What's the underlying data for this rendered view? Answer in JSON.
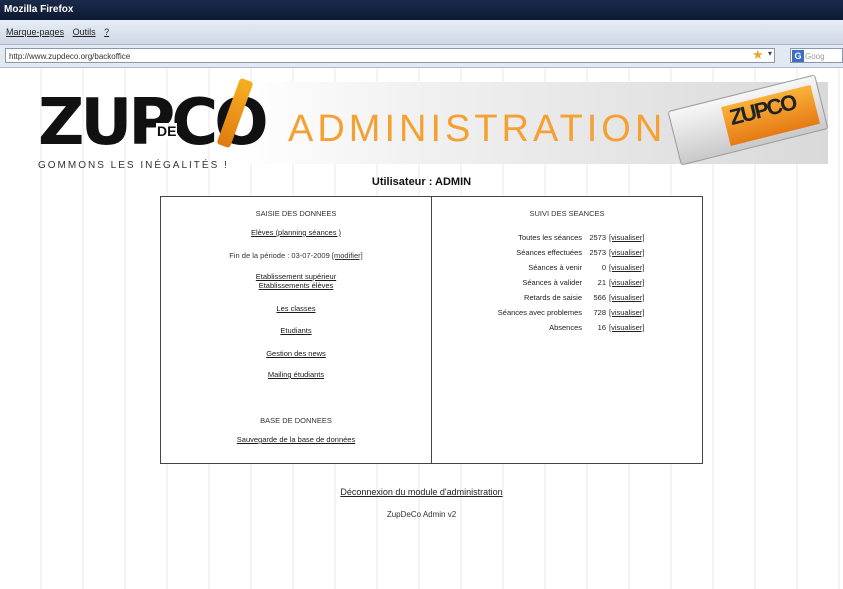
{
  "window": {
    "title": "Mozilla Firefox"
  },
  "menu": [
    "Marque-pages",
    "Outils",
    "?"
  ],
  "address": {
    "url": "http://www.zupdeco.org/backoffice",
    "search_placeholder": "Goog"
  },
  "header": {
    "logo_text": "ZUPCO",
    "logo_de": "DE",
    "logo_tagline": "GOMMONS LES INÉGALITÉS !",
    "title": "ADMINISTRATION",
    "eraser_text": "ZUPCO"
  },
  "user_line": "Utilisateur : ADMIN",
  "left": {
    "heading": "SAISIE DES DONNEES",
    "links": {
      "eleves": "Elèves (planning séances )",
      "period_text": "Fin de la période : 03-07-2009",
      "modify": "[modifier]",
      "etab_sup": "Etablissement supérieur",
      "etab_eleves": "Etablissements élèves",
      "classes": "Les classes",
      "etudiants": "Etudiants",
      "news": "Gestion des news",
      "mailing": "Mailing étudiants"
    },
    "db_heading": "BASE DE DONNEES",
    "db_backup": "Sauvegarde de la base de données"
  },
  "right": {
    "heading": "SUIVI DES SEANCES",
    "view_label": "[visualiser]",
    "stats": [
      {
        "label": "Toutes les séances",
        "value": "2573"
      },
      {
        "label": "Séances effectuées",
        "value": "2573"
      },
      {
        "label": "Séances à venir",
        "value": "0"
      },
      {
        "label": "Séances à valider",
        "value": "21"
      },
      {
        "label": "Retards de saisie",
        "value": "566"
      },
      {
        "label": "Séances avec problemes",
        "value": "728"
      },
      {
        "label": "Absences",
        "value": "16"
      }
    ]
  },
  "footer": {
    "logout": "Déconnexion du module d'administration",
    "version": "ZupDeCo Admin v2"
  }
}
